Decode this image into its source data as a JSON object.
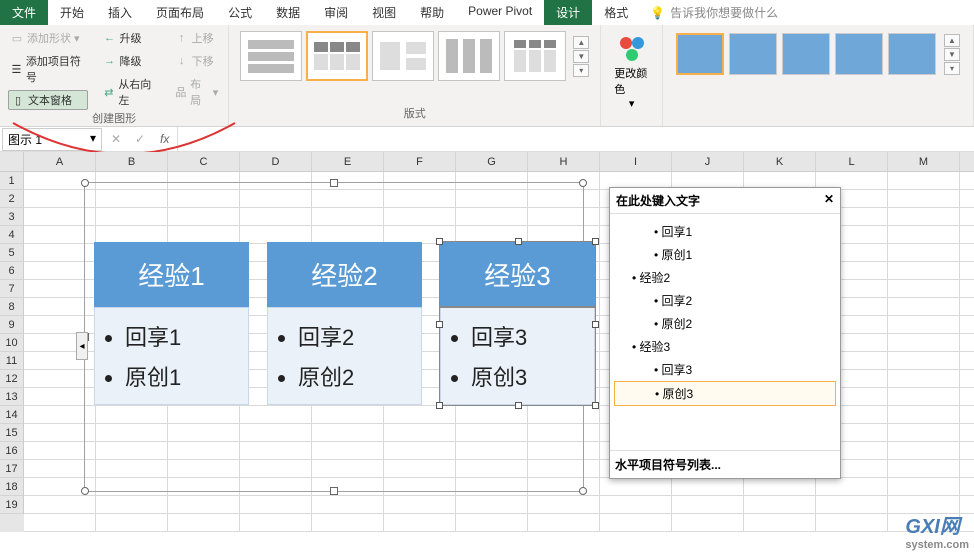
{
  "tabs": {
    "file": "文件",
    "home": "开始",
    "insert": "插入",
    "layout": "页面布局",
    "formulas": "公式",
    "data": "数据",
    "review": "审阅",
    "view": "视图",
    "help": "帮助",
    "powerpivot": "Power Pivot",
    "design": "设计",
    "format": "格式"
  },
  "search_prompt": "告诉我你想要做什么",
  "ribbon": {
    "add_shape": "添加形状",
    "add_bullet": "添加项目符号",
    "text_pane": "文本窗格",
    "promote": "升级",
    "demote": "降级",
    "rtl": "从右向左",
    "move_up": "上移",
    "move_down": "下移",
    "layout_btn": "布局",
    "group_create": "创建图形",
    "group_layouts": "版式",
    "change_colors": "更改颜色"
  },
  "namebox": "图示 1",
  "fx": "fx",
  "columns": [
    "A",
    "B",
    "C",
    "D",
    "E",
    "F",
    "G",
    "H",
    "I",
    "J",
    "K",
    "L",
    "M"
  ],
  "rows": [
    "1",
    "2",
    "3",
    "4",
    "5",
    "6",
    "7",
    "8",
    "9",
    "10",
    "11",
    "12",
    "13",
    "14",
    "15",
    "16",
    "17",
    "18",
    "19"
  ],
  "smartart": [
    {
      "title": "经验1",
      "items": [
        "回享1",
        "原创1"
      ]
    },
    {
      "title": "经验2",
      "items": [
        "回享2",
        "原创2"
      ]
    },
    {
      "title": "经验3",
      "items": [
        "回享3",
        "原创3"
      ]
    }
  ],
  "textpane": {
    "title": "在此处键入文字",
    "items": [
      {
        "text": "回享1",
        "level": 2
      },
      {
        "text": "原创1",
        "level": 2
      },
      {
        "text": "经验2",
        "level": 1
      },
      {
        "text": "回享2",
        "level": 2
      },
      {
        "text": "原创2",
        "level": 2
      },
      {
        "text": "经验3",
        "level": 1
      },
      {
        "text": "回享3",
        "level": 2
      },
      {
        "text": "原创3",
        "level": 2,
        "editing": true
      }
    ],
    "footer": "水平项目符号列表..."
  },
  "watermark": {
    "main": "GXI网",
    "sub": "system.com"
  }
}
